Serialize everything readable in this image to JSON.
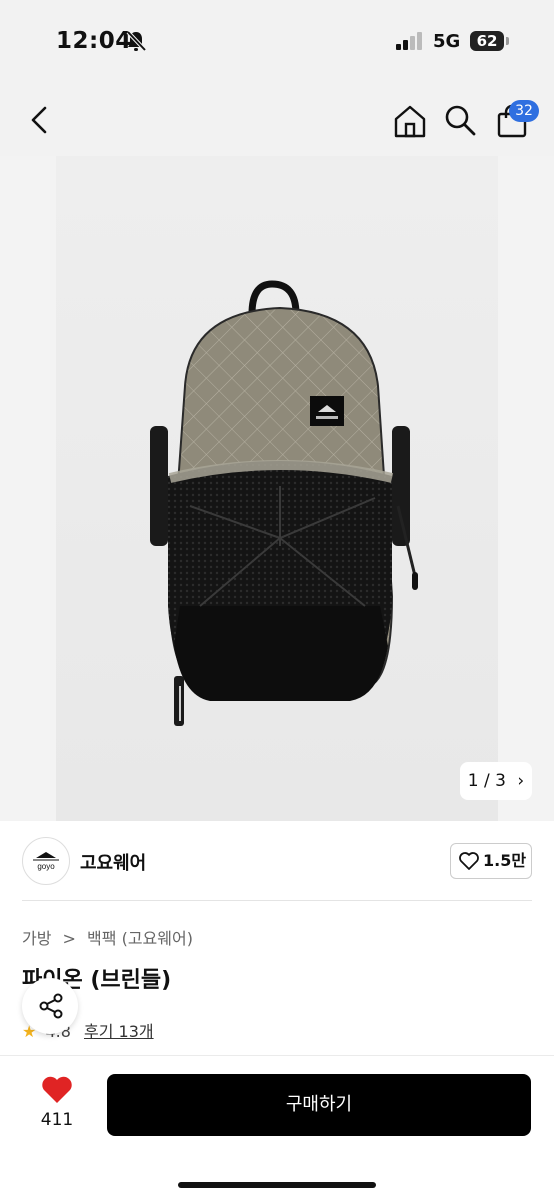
{
  "status_bar": {
    "time": "12:04",
    "network": "5G",
    "battery": "62"
  },
  "top_bar": {
    "cart_badge": "32"
  },
  "gallery": {
    "counter": "1 / 3",
    "counter_arrow": "›"
  },
  "brand": {
    "name": "고요웨어",
    "likes": "1.5만",
    "logo_text": "goyo"
  },
  "breadcrumb": {
    "category": "가방",
    "separator": ">",
    "subcategory": "백팩 (고요웨어)"
  },
  "product": {
    "title": "파이온 (브린들)",
    "rating_star": "★",
    "rating": "4.8",
    "reviews_label": "후기 13개"
  },
  "bottom_bar": {
    "wish_count": "411",
    "buy_label": "구매하기"
  },
  "colors": {
    "badge": "#2f6fe0",
    "star": "#f2b21e",
    "buy_button": "#000000",
    "heart": "#e02424"
  }
}
